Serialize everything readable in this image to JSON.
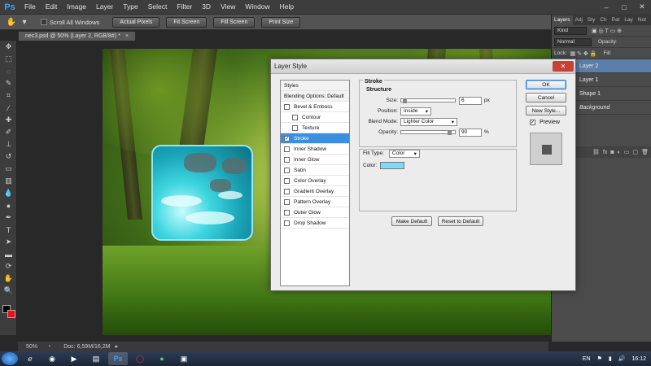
{
  "menubar": {
    "logo": "Ps",
    "items": [
      "File",
      "Edit",
      "Image",
      "Layer",
      "Type",
      "Select",
      "Filter",
      "3D",
      "View",
      "Window",
      "Help"
    ],
    "win_minimize": "–",
    "win_maximize": "□",
    "win_close": "✕"
  },
  "options": {
    "scroll_all": "Scroll All Windows",
    "buttons": [
      "Actual Pixels",
      "Fit Screen",
      "Fill Screen",
      "Print Size"
    ]
  },
  "document": {
    "tab_title": "nec3.psd @ 50% (Layer 2, RGB/8#) *",
    "close": "×"
  },
  "status": {
    "zoom": "50%",
    "doc_info": "Doc: 6,59M/16,2M"
  },
  "panels": {
    "tabs": [
      "Layers",
      "Adj",
      "Sty",
      "Ch",
      "Pat",
      "Lay",
      "Not"
    ],
    "kind": "Kind",
    "blend": "Normal",
    "opacity_label": "Opacity:",
    "lock_label": "Lock:",
    "fill_label": "Fill:",
    "layers": [
      "Layer 2",
      "Layer 1",
      "Shape 1",
      "Background"
    ]
  },
  "dialog": {
    "title": "Layer Style",
    "close": "✕",
    "styles": [
      {
        "label": "Styles",
        "type": "header"
      },
      {
        "label": "Blending Options: Default",
        "type": "header"
      },
      {
        "label": "Bevel & Emboss",
        "type": "check",
        "checked": false
      },
      {
        "label": "Contour",
        "type": "sub",
        "checked": false
      },
      {
        "label": "Texture",
        "type": "sub",
        "checked": false
      },
      {
        "label": "Stroke",
        "type": "check",
        "checked": true,
        "selected": true
      },
      {
        "label": "Inner Shadow",
        "type": "check",
        "checked": false
      },
      {
        "label": "Inner Glow",
        "type": "check",
        "checked": false
      },
      {
        "label": "Satin",
        "type": "check",
        "checked": false
      },
      {
        "label": "Color Overlay",
        "type": "check",
        "checked": false
      },
      {
        "label": "Gradient Overlay",
        "type": "check",
        "checked": false
      },
      {
        "label": "Pattern Overlay",
        "type": "check",
        "checked": false
      },
      {
        "label": "Outer Glow",
        "type": "check",
        "checked": false
      },
      {
        "label": "Drop Shadow",
        "type": "check",
        "checked": false
      }
    ],
    "stroke_title": "Stroke",
    "structure_title": "Structure",
    "size_label": "Size:",
    "size_value": "6",
    "size_unit": "px",
    "position_label": "Position:",
    "position_value": "Inside",
    "blend_label": "Blend Mode:",
    "blend_value": "Lighter Color",
    "opacity_label": "Opacity:",
    "opacity_value": "90",
    "opacity_unit": "%",
    "opacity_fraction": 0.9,
    "size_fraction": 0.03,
    "fill_type_label": "Fill Type:",
    "fill_type_value": "Color",
    "color_label": "Color:",
    "color_value": "#7bdcfa",
    "make_default": "Make Default",
    "reset_default": "Reset to Default",
    "ok": "OK",
    "cancel": "Cancel",
    "new_style": "New Style...",
    "preview": "Preview"
  },
  "taskbar": {
    "lang": "EN",
    "time": "16:12"
  }
}
